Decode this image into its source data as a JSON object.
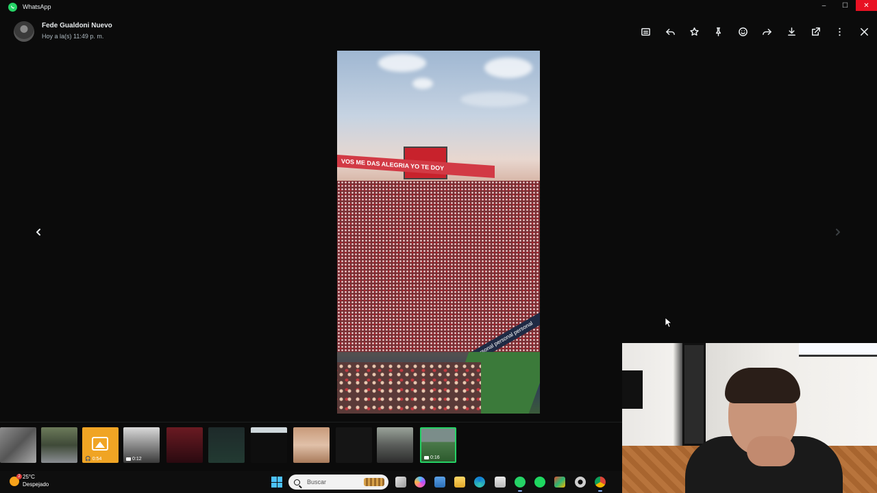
{
  "window": {
    "app_title": "WhatsApp",
    "app_icon": "whatsapp-icon",
    "controls": [
      "minimize-icon",
      "maximize-icon",
      "close-icon"
    ]
  },
  "header": {
    "contact_name": "Fede Gualdoni Nuevo",
    "timestamp": "Hoy a la(s) 11:49 p. m.",
    "toolbar_icons": [
      "caption-icon",
      "reply-icon",
      "star-icon",
      "pin-icon",
      "emoji-icon",
      "forward-icon",
      "download-icon",
      "open-external-icon",
      "more-icon",
      "close-icon"
    ]
  },
  "media": {
    "banner_text": "VOS ME DAS ALEGRIA YO TE DOY",
    "adboard_text": "personal  personal  personal"
  },
  "thumbnails": [
    {
      "kind": "image",
      "badge": ""
    },
    {
      "kind": "image",
      "badge": ""
    },
    {
      "kind": "audio-placeholder",
      "badge": "0:54"
    },
    {
      "kind": "video",
      "badge": "0:12"
    },
    {
      "kind": "image",
      "badge": ""
    },
    {
      "kind": "image",
      "badge": ""
    },
    {
      "kind": "image",
      "badge": ""
    },
    {
      "kind": "image",
      "badge": ""
    },
    {
      "kind": "image",
      "badge": ""
    },
    {
      "kind": "image",
      "badge": ""
    },
    {
      "kind": "video",
      "badge": "0:16",
      "active": true
    }
  ],
  "taskbar": {
    "weather_temp": "25°C",
    "weather_condition": "Despejado",
    "weather_badge": "2",
    "search_placeholder": "Buscar",
    "pinned_icons": [
      "task-view-icon",
      "copilot-icon",
      "photos-icon",
      "file-explorer-icon",
      "edge-icon",
      "store-icon",
      "whatsapp-icon",
      "spotify-icon",
      "office-icon",
      "settings-icon",
      "chrome-icon"
    ]
  },
  "colors": {
    "accent": "#25d366",
    "background": "#0b0b0b",
    "close_red": "#e81123"
  }
}
